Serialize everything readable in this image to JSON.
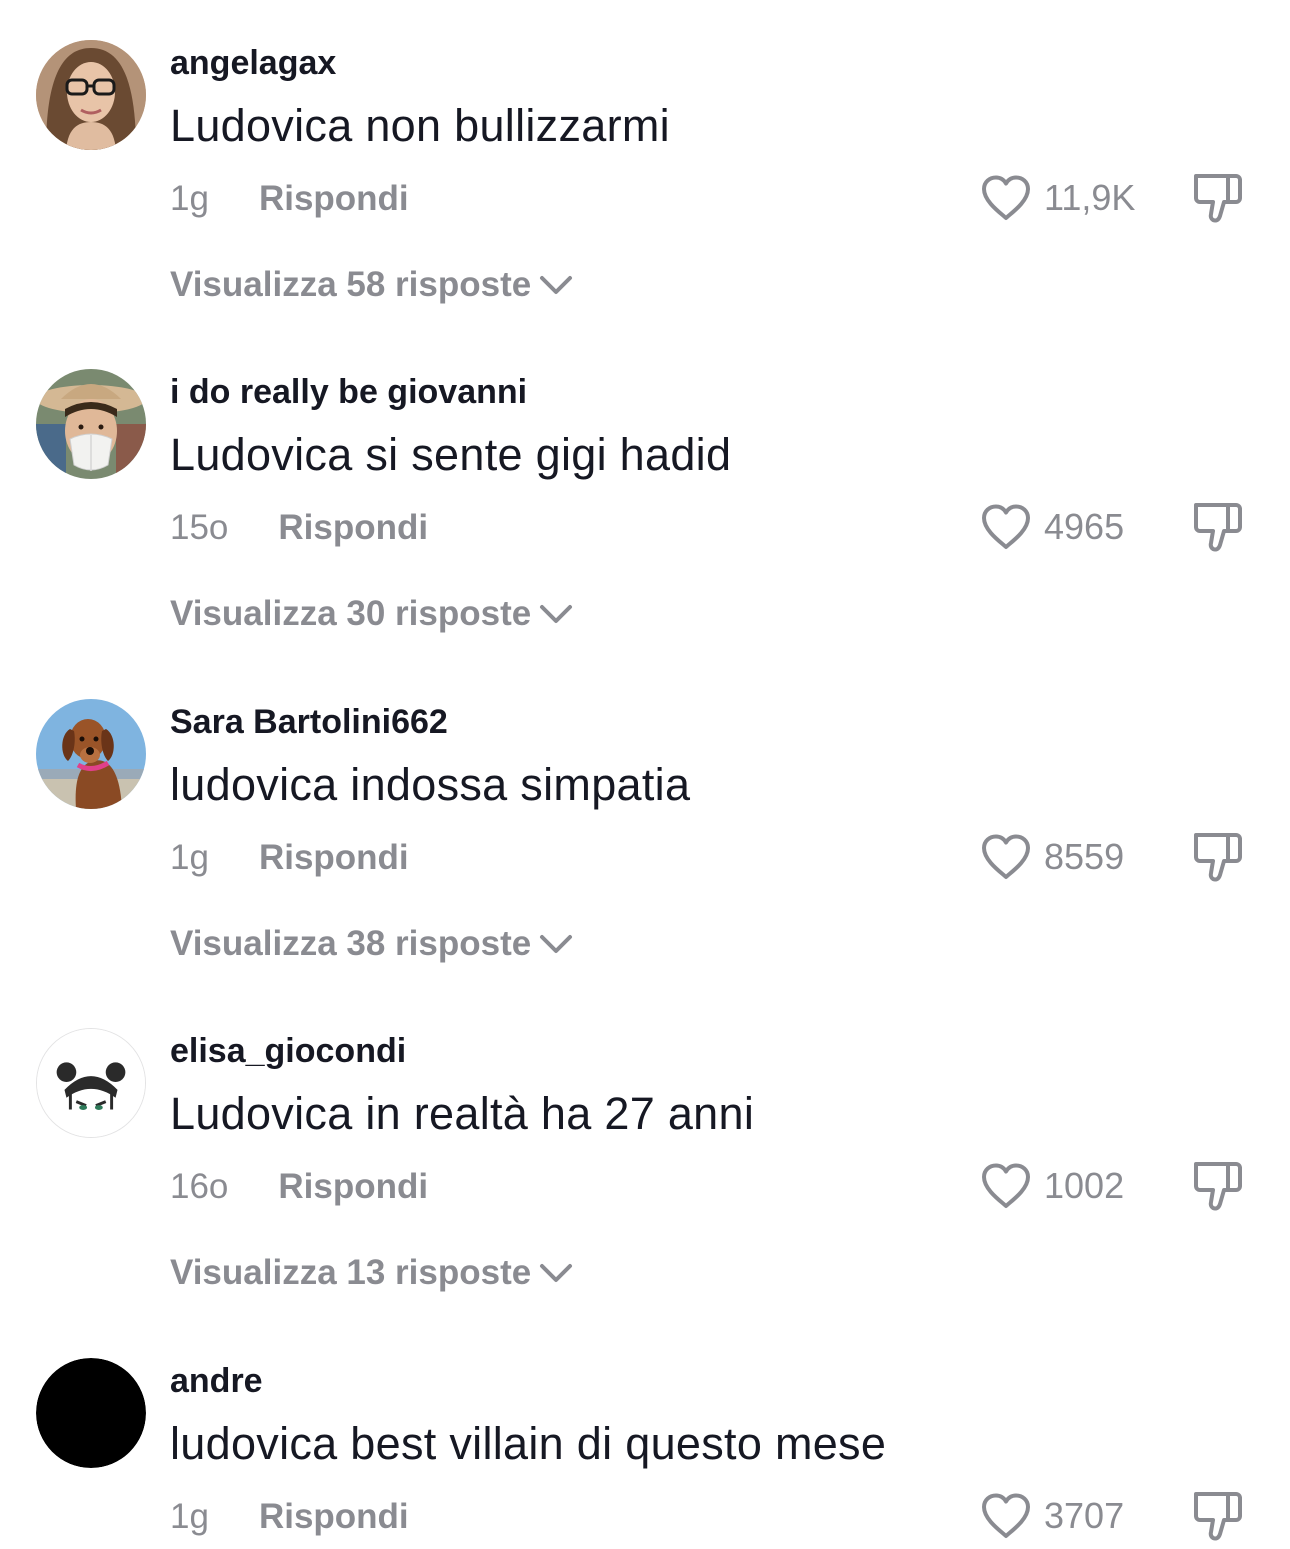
{
  "comments": [
    {
      "username": "angelagax",
      "text": "Ludovica non bullizzarmi",
      "time": "1g",
      "reply_label": "Rispondi",
      "likes": "11,9K",
      "view_replies": "Visualizza 58 risposte",
      "avatar_icon": "woman-with-glasses-photo"
    },
    {
      "username": "i do really be giovanni",
      "text": "Ludovica si sente gigi hadid",
      "time": "15o",
      "reply_label": "Rispondi",
      "likes": "4965",
      "view_replies": "Visualizza 30 risposte",
      "avatar_icon": "man-with-hat-and-mask-photo"
    },
    {
      "username": "Sara Bartolini662",
      "text": "ludovica indossa simpatia",
      "time": "1g",
      "reply_label": "Rispondi",
      "likes": "8559",
      "view_replies": "Visualizza 38 risposte",
      "avatar_icon": "dachshund-dog-photo"
    },
    {
      "username": "elisa_giocondi",
      "text": "Ludovica in realtà ha 27 anni",
      "time": "16o",
      "reply_label": "Rispondi",
      "likes": "1002",
      "view_replies": "Visualizza 13 risposte",
      "avatar_icon": "cartoon-girl-buns-drawing"
    },
    {
      "username": "andre",
      "text": "ludovica best villain di questo mese",
      "time": "1g",
      "reply_label": "Rispondi",
      "likes": "3707",
      "avatar_icon": "black-circle"
    }
  ],
  "colors": {
    "text_primary": "#161823",
    "text_secondary": "#8a8b91",
    "background": "#ffffff"
  }
}
